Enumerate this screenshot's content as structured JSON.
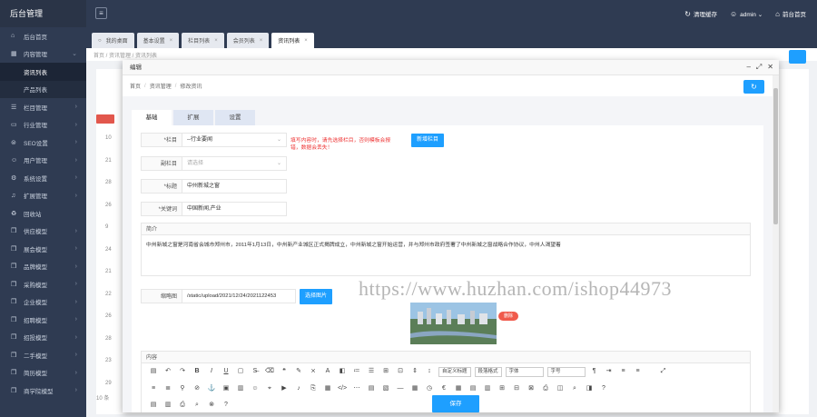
{
  "sidebar": {
    "brand": "后台管理",
    "items": [
      {
        "label": "后台首页",
        "icon": "home-icon",
        "glyph": "⌂"
      },
      {
        "label": "内容管理",
        "icon": "grid-icon",
        "glyph": "▦",
        "expanded": true
      },
      {
        "label": "栏目管理",
        "icon": "list-icon",
        "glyph": "☰"
      },
      {
        "label": "行业管理",
        "icon": "card-icon",
        "glyph": "▭"
      },
      {
        "label": "SEO设置",
        "icon": "seo-icon",
        "glyph": "⊜"
      },
      {
        "label": "用户管理",
        "icon": "user-icon",
        "glyph": "☺"
      },
      {
        "label": "系统设置",
        "icon": "settings-icon",
        "glyph": "⚙"
      },
      {
        "label": "扩展管理",
        "icon": "bell-icon",
        "glyph": "♫"
      },
      {
        "label": "回收站",
        "icon": "trash-icon",
        "glyph": "♻"
      },
      {
        "label": "供应模型",
        "icon": "cube-icon",
        "glyph": "❒"
      },
      {
        "label": "展会模型",
        "icon": "cube-icon",
        "glyph": "❒"
      },
      {
        "label": "品牌模型",
        "icon": "cube-icon",
        "glyph": "❒"
      },
      {
        "label": "采购模型",
        "icon": "cube-icon",
        "glyph": "❒"
      },
      {
        "label": "企业模型",
        "icon": "cube-icon",
        "glyph": "❒"
      },
      {
        "label": "招聘模型",
        "icon": "cube-icon",
        "glyph": "❒"
      },
      {
        "label": "招投模型",
        "icon": "cube-icon",
        "glyph": "❒"
      },
      {
        "label": "二手模型",
        "icon": "cube-icon",
        "glyph": "❒"
      },
      {
        "label": "简历模型",
        "icon": "cube-icon",
        "glyph": "❒"
      },
      {
        "label": "商学院模型",
        "icon": "cube-icon",
        "glyph": "❒"
      }
    ],
    "submenu": [
      "资讯列表",
      "产品列表"
    ]
  },
  "topbar": {
    "clear_cache": "清理缓存",
    "user": "admin",
    "home": "前台首页"
  },
  "tabs": [
    {
      "label": "我的桌面",
      "active": false,
      "closable": false
    },
    {
      "label": "基本设置",
      "active": false,
      "closable": true
    },
    {
      "label": "栏目列表",
      "active": false,
      "closable": true
    },
    {
      "label": "会员列表",
      "active": false,
      "closable": true
    },
    {
      "label": "资讯列表",
      "active": true,
      "closable": true
    }
  ],
  "background": {
    "crumb": "首页 / 资讯管理 / 资讯列表",
    "numbers": [
      "10",
      "21",
      "28",
      "26",
      "9",
      "24",
      "21",
      "22",
      "26",
      "28",
      "23",
      "29"
    ],
    "footer_text": "10 条"
  },
  "modal": {
    "title": "编辑",
    "breadcrumb": [
      "首页",
      "资讯管理",
      "修改资讯"
    ],
    "form_tabs": [
      "基础",
      "扩展",
      "设置"
    ],
    "fields": {
      "column_label": "*栏目",
      "column_value": "--行业要闻",
      "column_warning": "填写内容时，请先选择栏目，否则模板会报错，数据会丢失！",
      "add_column_button": "新增栏目",
      "subcolumn_label": "副栏目",
      "subcolumn_placeholder": "请选择",
      "title_label": "*标题",
      "title_value": "中州新城之窗",
      "short_title_label": "*关键词",
      "short_title_value": "中国新闻,产业"
    },
    "summary": {
      "label": "简介",
      "text": "中州新城之窗是河南省会城市郑州市，2011年1月13日，中州新产业城区正式揭牌成立，中州新城之窗开始运营，并与郑州市政府签署了中州新城之窗战略合作协议，中州人渴望着"
    },
    "thumbnail": {
      "label": "缩略图",
      "path": "/static/upload/2021/12/24/2021122453",
      "choose_button": "选择图片",
      "delete_button": "删除"
    },
    "content_label": "内容",
    "editor_selects": [
      "自定义标题",
      "段落格式",
      "字体",
      "字号"
    ],
    "save_button": "保存"
  },
  "watermark": "https://www.huzhan.com/ishop44973"
}
